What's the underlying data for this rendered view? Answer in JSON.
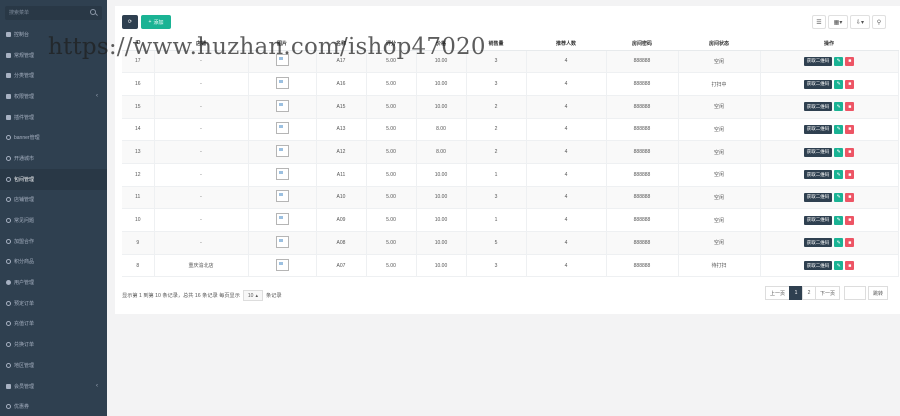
{
  "sidebar": {
    "search_placeholder": "搜索菜单",
    "items": [
      {
        "label": "控制台",
        "icon": "dashboard-icon",
        "arrow": ""
      },
      {
        "label": "常规管理",
        "icon": "cogs-icon",
        "arrow": ""
      },
      {
        "label": "分类管理",
        "icon": "tags-icon",
        "arrow": ""
      },
      {
        "label": "权限管理",
        "icon": "group-icon",
        "arrow": "‹"
      },
      {
        "label": "插件管理",
        "icon": "rocket-icon",
        "arrow": ""
      },
      {
        "label": "banner管理",
        "icon": "circle-icon",
        "arrow": ""
      },
      {
        "label": "开通城市",
        "icon": "circle-icon",
        "arrow": ""
      },
      {
        "label": "包间管理",
        "icon": "circle-icon",
        "arrow": ""
      },
      {
        "label": "店铺管理",
        "icon": "circle-icon",
        "arrow": ""
      },
      {
        "label": "常见问题",
        "icon": "circle-icon",
        "arrow": ""
      },
      {
        "label": "加盟合作",
        "icon": "circle-icon",
        "arrow": ""
      },
      {
        "label": "积分商品",
        "icon": "circle-icon",
        "arrow": ""
      },
      {
        "label": "用户管理",
        "icon": "user-icon",
        "arrow": ""
      },
      {
        "label": "预定订单",
        "icon": "circle-icon",
        "arrow": ""
      },
      {
        "label": "充值订单",
        "icon": "circle-icon",
        "arrow": ""
      },
      {
        "label": "兑换订单",
        "icon": "circle-icon",
        "arrow": ""
      },
      {
        "label": "地区管理",
        "icon": "circle-icon",
        "arrow": ""
      },
      {
        "label": "会员管理",
        "icon": "list-icon",
        "arrow": "‹"
      },
      {
        "label": "优惠券",
        "icon": "circle-icon",
        "arrow": ""
      }
    ],
    "active_index": 7
  },
  "toolbar": {
    "add_label": "添加",
    "add_icon": "plus-icon",
    "refresh_icon": "refresh-icon",
    "tools": [
      "list-icon",
      "columns-icon",
      "export-icon",
      "search-icon"
    ]
  },
  "table": {
    "headers": [
      "ID",
      "店铺",
      "图片",
      "名称",
      "评分",
      "价格",
      "销售量",
      "推荐人数",
      "房间密码",
      "房间状态",
      "操作"
    ],
    "rows": [
      [
        "17",
        "-",
        "",
        "A17",
        "5.00",
        "10.00",
        "3",
        "4",
        "888888",
        "空闲"
      ],
      [
        "16",
        "-",
        "",
        "A16",
        "5.00",
        "10.00",
        "3",
        "4",
        "888888",
        "打扫中"
      ],
      [
        "15",
        "-",
        "",
        "A15",
        "5.00",
        "10.00",
        "2",
        "4",
        "888888",
        "空闲"
      ],
      [
        "14",
        "-",
        "",
        "A13",
        "5.00",
        "8.00",
        "2",
        "4",
        "888888",
        "空闲"
      ],
      [
        "13",
        "-",
        "",
        "A12",
        "5.00",
        "8.00",
        "2",
        "4",
        "888888",
        "空闲"
      ],
      [
        "12",
        "-",
        "",
        "A11",
        "5.00",
        "10.00",
        "1",
        "4",
        "888888",
        "空闲"
      ],
      [
        "11",
        "-",
        "",
        "A10",
        "5.00",
        "10.00",
        "3",
        "4",
        "888888",
        "空闲"
      ],
      [
        "10",
        "-",
        "",
        "A09",
        "5.00",
        "10.00",
        "1",
        "4",
        "888888",
        "空闲"
      ],
      [
        "9",
        "-",
        "",
        "A08",
        "5.00",
        "10.00",
        "5",
        "4",
        "888888",
        "空闲"
      ],
      [
        "8",
        "重庆渝北店",
        "",
        "A07",
        "5.00",
        "10.00",
        "3",
        "4",
        "888888",
        "待打扫"
      ]
    ],
    "op_qr_label": "获取二维码"
  },
  "pager": {
    "info_prefix": "显示第 1 到第 10 条记录，总共 16 条记录 每页显示",
    "page_size": "10",
    "info_suffix": "条记录",
    "prev": "上一页",
    "pages": [
      "1",
      "2"
    ],
    "active_page": "1",
    "next": "下一页",
    "jump": "跳转"
  },
  "watermark": "https://www.huzhan.com/ishop47020",
  "colors": {
    "sidebar_bg": "#2f4050",
    "primary": "#1ab394",
    "danger": "#ed5565"
  }
}
